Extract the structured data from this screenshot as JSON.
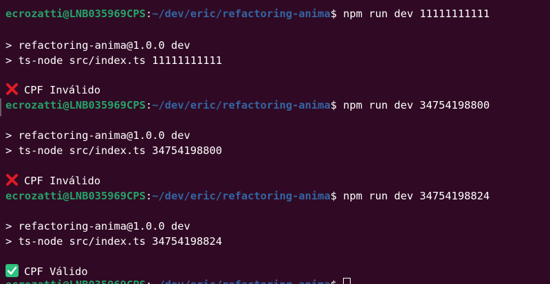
{
  "prompt": {
    "user_host": "ecrozatti@LNB035969CPS",
    "separator": ":",
    "path": "~/dev/eric/refactoring-anima",
    "symbol": "$"
  },
  "runs": [
    {
      "command": "npm run dev 11111111111",
      "output_line_1": "> refactoring-anima@1.0.0 dev",
      "output_line_2": "> ts-node src/index.ts 11111111111",
      "result_icon": "red-x-icon",
      "result_text": "CPF Inválido"
    },
    {
      "command": "npm run dev 34754198800",
      "output_line_1": "> refactoring-anima@1.0.0 dev",
      "output_line_2": "> ts-node src/index.ts 34754198800",
      "result_icon": "red-x-icon",
      "result_text": "CPF Inválido"
    },
    {
      "command": "npm run dev 34754198824",
      "output_line_1": "> refactoring-anima@1.0.0 dev",
      "output_line_2": "> ts-node src/index.ts 34754198824",
      "result_icon": "green-check-icon",
      "result_text": "CPF Válido"
    }
  ],
  "colors": {
    "background": "#300a24",
    "user_host": "#26a269",
    "path": "#3465a4",
    "text": "#ffffff",
    "error_icon": "#e01b24",
    "success_icon": "#2ec27e"
  }
}
